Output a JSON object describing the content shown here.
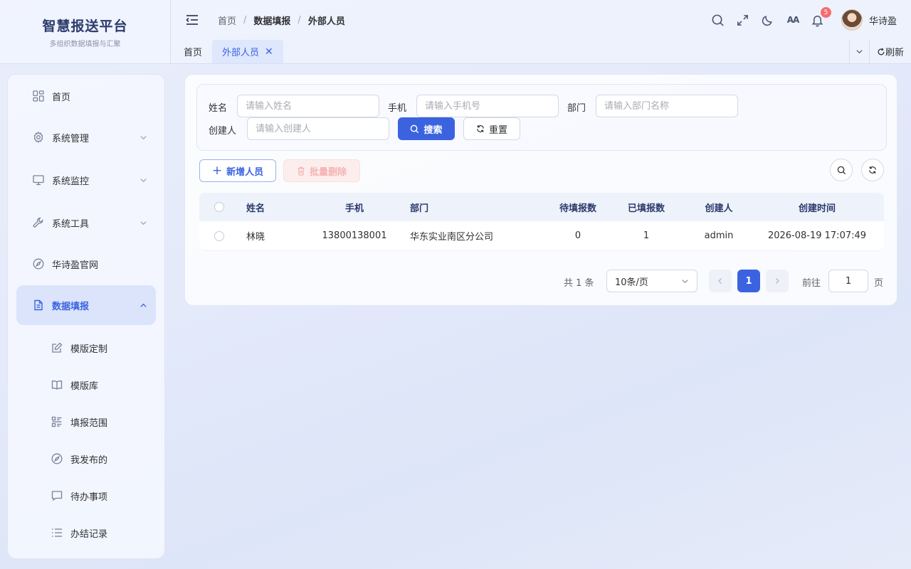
{
  "app": {
    "title": "智慧报送平台",
    "subtitle": "多组织数据填报与汇聚"
  },
  "breadcrumb": [
    "首页",
    "数据填报",
    "外部人员"
  ],
  "header": {
    "notification_count": "5",
    "username": "华诗盈"
  },
  "tabs": [
    {
      "label": "首页",
      "active": false
    },
    {
      "label": "外部人员",
      "active": true,
      "closable": true
    }
  ],
  "tabs_actions": {
    "refresh": "刷新"
  },
  "sidebar": {
    "items": [
      {
        "label": "首页",
        "icon": "dashboard-icon"
      },
      {
        "label": "系统管理",
        "icon": "gear-icon",
        "expandable": true
      },
      {
        "label": "系统监控",
        "icon": "monitor-icon",
        "expandable": true
      },
      {
        "label": "系统工具",
        "icon": "wrench-icon",
        "expandable": true
      },
      {
        "label": "华诗盈官网",
        "icon": "compass-icon"
      },
      {
        "label": "数据填报",
        "icon": "document-icon",
        "expandable": true,
        "expanded": true,
        "active": true
      }
    ],
    "sub_items": [
      {
        "label": "模版定制",
        "icon": "edit-icon"
      },
      {
        "label": "模版库",
        "icon": "book-icon"
      },
      {
        "label": "填报范围",
        "icon": "list-grid-icon"
      },
      {
        "label": "我发布的",
        "icon": "compass-icon"
      },
      {
        "label": "待办事项",
        "icon": "chat-icon"
      },
      {
        "label": "办结记录",
        "icon": "list-icon"
      }
    ]
  },
  "search": {
    "name_label": "姓名",
    "name_placeholder": "请输入姓名",
    "name_value": "",
    "phone_label": "手机",
    "phone_placeholder": "请输入手机号",
    "phone_value": "",
    "dept_label": "部门",
    "dept_placeholder": "请输入部门名称",
    "dept_value": "",
    "creator_label": "创建人",
    "creator_placeholder": "请输入创建人",
    "creator_value": "",
    "search_button": "搜索",
    "reset_button": "重置"
  },
  "toolbar": {
    "add_button": "新增人员",
    "batch_delete_button": "批量删除"
  },
  "table": {
    "columns": [
      "姓名",
      "手机",
      "部门",
      "待填报数",
      "已填报数",
      "创建人",
      "创建时间"
    ],
    "rows": [
      [
        "林晓",
        "13800138001",
        "华东实业南区分公司",
        "0",
        "1",
        "admin",
        "2026-08-19 17:07:49"
      ]
    ]
  },
  "pagination": {
    "total_text": "共 1 条",
    "page_size": "10条/页",
    "current_page": "1",
    "goto_label": "前往",
    "goto_value": "1",
    "goto_suffix": "页"
  },
  "colors": {
    "primary": "#3b63e0",
    "badge": "#f56c6c"
  }
}
